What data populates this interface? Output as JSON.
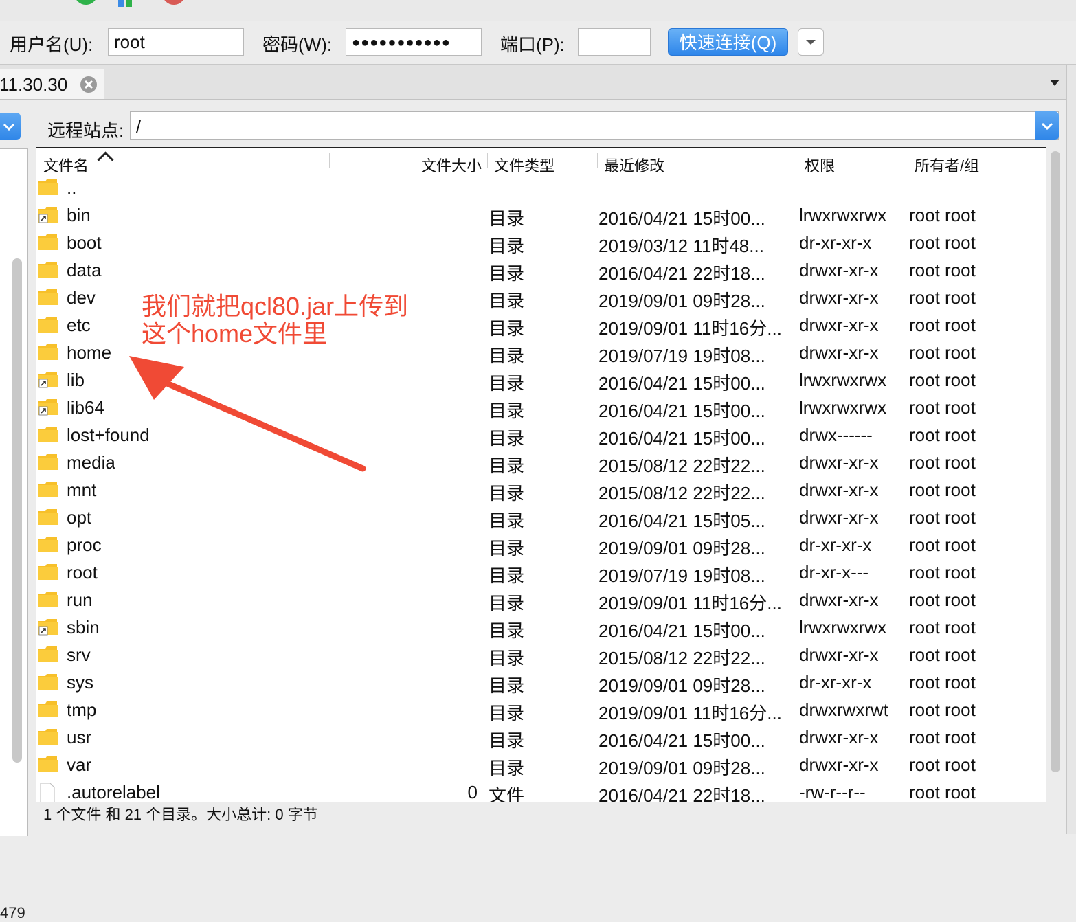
{
  "quickconnect": {
    "username_label": "用户名(U):",
    "username_value": "root",
    "password_label": "密码(W):",
    "password_value": "●●●●●●●●●●●",
    "port_label": "端口(P):",
    "port_value": "",
    "connect_label": "快速连接(Q)"
  },
  "tab": {
    "label": "11.30.30"
  },
  "left": {
    "status": "479"
  },
  "remote": {
    "site_label": "远程站点:",
    "path": "/",
    "columns": {
      "name": "文件名",
      "size": "文件大小",
      "type": "文件类型",
      "modified": "最近修改",
      "perm": "权限",
      "owner": "所有者/组"
    },
    "rows": [
      {
        "name": "..",
        "size": "",
        "type": "",
        "modified": "",
        "perm": "",
        "owner": "",
        "icon": "folder-icon"
      },
      {
        "name": "bin",
        "size": "",
        "type": "目录",
        "modified": "2016/04/21 15时00...",
        "perm": "lrwxrwxrwx",
        "owner": "root root",
        "icon": "folder-link-icon"
      },
      {
        "name": "boot",
        "size": "",
        "type": "目录",
        "modified": "2019/03/12 11时48...",
        "perm": "dr-xr-xr-x",
        "owner": "root root",
        "icon": "folder-icon"
      },
      {
        "name": "data",
        "size": "",
        "type": "目录",
        "modified": "2016/04/21 22时18...",
        "perm": "drwxr-xr-x",
        "owner": "root root",
        "icon": "folder-icon"
      },
      {
        "name": "dev",
        "size": "",
        "type": "目录",
        "modified": "2019/09/01 09时28...",
        "perm": "drwxr-xr-x",
        "owner": "root root",
        "icon": "folder-icon"
      },
      {
        "name": "etc",
        "size": "",
        "type": "目录",
        "modified": "2019/09/01 11时16分...",
        "perm": "drwxr-xr-x",
        "owner": "root root",
        "icon": "folder-icon"
      },
      {
        "name": "home",
        "size": "",
        "type": "目录",
        "modified": "2019/07/19 19时08...",
        "perm": "drwxr-xr-x",
        "owner": "root root",
        "icon": "folder-icon"
      },
      {
        "name": "lib",
        "size": "",
        "type": "目录",
        "modified": "2016/04/21 15时00...",
        "perm": "lrwxrwxrwx",
        "owner": "root root",
        "icon": "folder-link-icon"
      },
      {
        "name": "lib64",
        "size": "",
        "type": "目录",
        "modified": "2016/04/21 15时00...",
        "perm": "lrwxrwxrwx",
        "owner": "root root",
        "icon": "folder-link-icon"
      },
      {
        "name": "lost+found",
        "size": "",
        "type": "目录",
        "modified": "2016/04/21 15时00...",
        "perm": "drwx------",
        "owner": "root root",
        "icon": "folder-icon"
      },
      {
        "name": "media",
        "size": "",
        "type": "目录",
        "modified": "2015/08/12 22时22...",
        "perm": "drwxr-xr-x",
        "owner": "root root",
        "icon": "folder-icon"
      },
      {
        "name": "mnt",
        "size": "",
        "type": "目录",
        "modified": "2015/08/12 22时22...",
        "perm": "drwxr-xr-x",
        "owner": "root root",
        "icon": "folder-icon"
      },
      {
        "name": "opt",
        "size": "",
        "type": "目录",
        "modified": "2016/04/21 15时05...",
        "perm": "drwxr-xr-x",
        "owner": "root root",
        "icon": "folder-icon"
      },
      {
        "name": "proc",
        "size": "",
        "type": "目录",
        "modified": "2019/09/01 09时28...",
        "perm": "dr-xr-xr-x",
        "owner": "root root",
        "icon": "folder-icon"
      },
      {
        "name": "root",
        "size": "",
        "type": "目录",
        "modified": "2019/07/19 19时08...",
        "perm": "dr-xr-x---",
        "owner": "root root",
        "icon": "folder-icon"
      },
      {
        "name": "run",
        "size": "",
        "type": "目录",
        "modified": "2019/09/01 11时16分...",
        "perm": "drwxr-xr-x",
        "owner": "root root",
        "icon": "folder-icon"
      },
      {
        "name": "sbin",
        "size": "",
        "type": "目录",
        "modified": "2016/04/21 15时00...",
        "perm": "lrwxrwxrwx",
        "owner": "root root",
        "icon": "folder-link-icon"
      },
      {
        "name": "srv",
        "size": "",
        "type": "目录",
        "modified": "2015/08/12 22时22...",
        "perm": "drwxr-xr-x",
        "owner": "root root",
        "icon": "folder-icon"
      },
      {
        "name": "sys",
        "size": "",
        "type": "目录",
        "modified": "2019/09/01 09时28...",
        "perm": "dr-xr-xr-x",
        "owner": "root root",
        "icon": "folder-icon"
      },
      {
        "name": "tmp",
        "size": "",
        "type": "目录",
        "modified": "2019/09/01 11时16分...",
        "perm": "drwxrwxrwt",
        "owner": "root root",
        "icon": "folder-icon"
      },
      {
        "name": "usr",
        "size": "",
        "type": "目录",
        "modified": "2016/04/21 15时00...",
        "perm": "drwxr-xr-x",
        "owner": "root root",
        "icon": "folder-icon"
      },
      {
        "name": "var",
        "size": "",
        "type": "目录",
        "modified": "2019/09/01 09时28...",
        "perm": "drwxr-xr-x",
        "owner": "root root",
        "icon": "folder-icon"
      },
      {
        "name": ".autorelabel",
        "size": "0",
        "type": "文件",
        "modified": "2016/04/21 22时18...",
        "perm": "-rw-r--r--",
        "owner": "root root",
        "icon": "file-icon"
      }
    ],
    "status": "1 个文件 和 21 个目录。大小总计: 0 字节"
  },
  "annotation": {
    "line1": "我们就把qcl80.jar上传到",
    "line2": "这个home文件里",
    "color": "#f04a35"
  },
  "colors": {
    "accent": "#2f86e8",
    "folder": "#f7c02a"
  }
}
